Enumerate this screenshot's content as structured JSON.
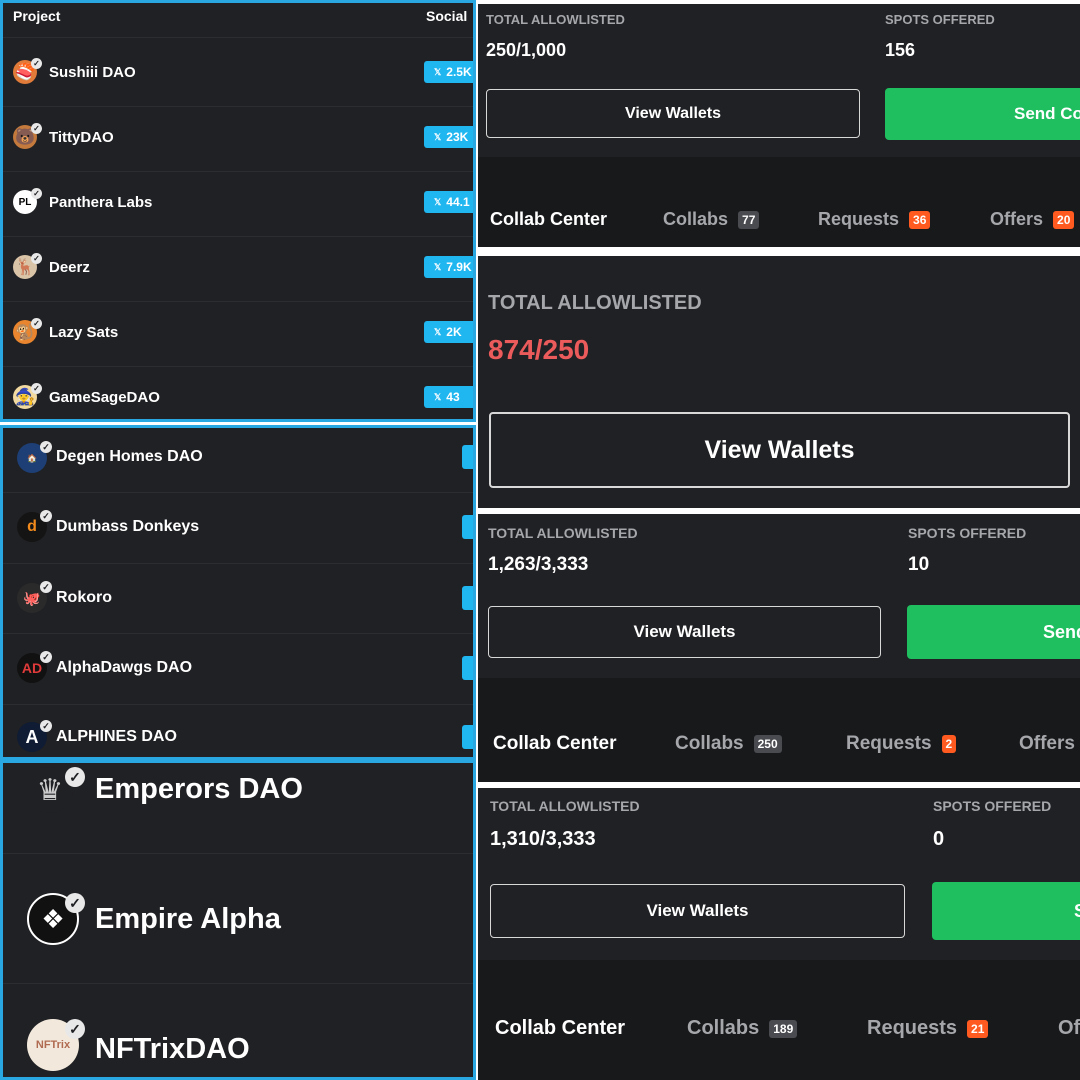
{
  "panel_a": {
    "header_project": "Project",
    "header_social": "Social",
    "rows": [
      {
        "name": "Sushiii DAO",
        "social": "2.5K"
      },
      {
        "name": "TittyDAO",
        "social": "23K"
      },
      {
        "name": "Panthera Labs",
        "social": "44.1"
      },
      {
        "name": "Deerz",
        "social": "7.9K"
      },
      {
        "name": "Lazy Sats",
        "social": "2K"
      },
      {
        "name": "GameSageDAO",
        "social": "43"
      }
    ],
    "twitter_glyph": "𝕏"
  },
  "panel_b": {
    "rows": [
      {
        "name": "Degen Homes DAO"
      },
      {
        "name": "Dumbass Donkeys"
      },
      {
        "name": "Rokoro"
      },
      {
        "name": "AlphaDawgs DAO"
      },
      {
        "name": "ALPHINES DAO"
      }
    ]
  },
  "panel_c": {
    "rows": [
      {
        "name": "Emperors DAO"
      },
      {
        "name": "Empire Alpha"
      },
      {
        "name": "NFTrixDAO"
      }
    ]
  },
  "card_1": {
    "total_label": "TOTAL ALLOWLISTED",
    "total_value": "250/1,000",
    "spots_label": "SPOTS OFFERED",
    "spots_value": "156",
    "view_wallets": "View Wallets",
    "send_button": "Send Co",
    "tabs": {
      "collab_center": "Collab Center",
      "collabs": "Collabs",
      "collabs_count": "77",
      "requests": "Requests",
      "requests_count": "36",
      "offers": "Offers",
      "offers_count": "20"
    }
  },
  "card_2": {
    "total_label": "TOTAL ALLOWLISTED",
    "total_value": "874/250",
    "view_wallets": "View Wallets"
  },
  "card_3": {
    "total_label": "TOTAL ALLOWLISTED",
    "total_value": "1,263/3,333",
    "spots_label": "SPOTS OFFERED",
    "spots_value": "10",
    "view_wallets": "View Wallets",
    "send_button": "Send",
    "tabs": {
      "collab_center": "Collab Center",
      "collabs": "Collabs",
      "collabs_count": "250",
      "requests": "Requests",
      "requests_count": "2",
      "offers": "Offers"
    }
  },
  "card_4": {
    "total_label": "TOTAL ALLOWLISTED",
    "total_value": "1,310/3,333",
    "spots_label": "SPOTS OFFERED",
    "spots_value": "0",
    "view_wallets": "View Wallets",
    "send_button": "S",
    "tabs": {
      "collab_center": "Collab Center",
      "collabs": "Collabs",
      "collabs_count": "189",
      "requests": "Requests",
      "requests_count": "21",
      "offers": "Of"
    }
  },
  "colors": {
    "panel_bg": "#202124",
    "accent_blue": "#29a7e1",
    "social_blue": "#20b6f0",
    "green": "#1fbf5f",
    "red_value": "#ec5b5b",
    "badge_red": "#ff5a1f"
  }
}
